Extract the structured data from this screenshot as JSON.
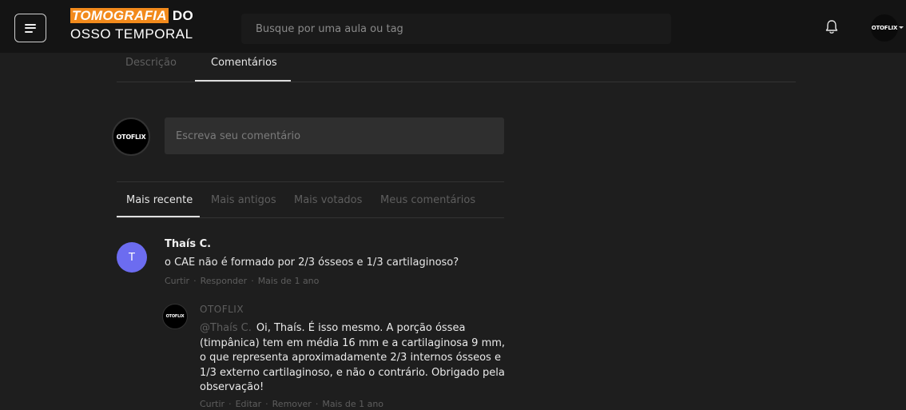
{
  "header": {
    "logo_line1_highlight": "TOMOGRAFIA",
    "logo_line1_rest": " DO",
    "logo_line2": "OSSO TEMPORAL",
    "search_placeholder": "Busque por uma aula ou tag",
    "user_avatar_text": "OTOFLIX"
  },
  "tabs": [
    {
      "label": "Descrição",
      "active": false
    },
    {
      "label": "Comentários",
      "active": true
    }
  ],
  "composer": {
    "avatar_text": "OTOFLIX",
    "placeholder": "Escreva seu comentário"
  },
  "sort_tabs": [
    {
      "label": "Mais recente",
      "active": true
    },
    {
      "label": "Mais antigos",
      "active": false
    },
    {
      "label": "Mais votados",
      "active": false
    },
    {
      "label": "Meus comentários",
      "active": false
    }
  ],
  "comment": {
    "avatar_initial": "T",
    "avatar_color": "#6c6cf0",
    "author": "Thaís C.",
    "text": "o CAE não é formado por 2/3 ósseos e 1/3 cartilaginoso?",
    "actions": [
      "Curtir",
      "Responder"
    ],
    "time": "Mais de 1 ano"
  },
  "reply": {
    "avatar_text": "OTOFLIX",
    "author": "OTOFLIX",
    "mention": "@Thaís C.",
    "text": "Oi, Thaís. É isso mesmo. A porção óssea (timpânica) tem em média 16 mm e a cartilaginosa 9 mm, o que representa aproximadamente 2/3 internos ósseos e 1/3 externo cartilaginoso, e não o contrário. Obrigado pela observação!",
    "actions": [
      "Curtir",
      "Editar",
      "Remover"
    ],
    "time": "Mais de 1 ano"
  },
  "colors": {
    "background": "#1e1e1e",
    "topbar": "#141414",
    "logo_highlight": "#f28a1c"
  }
}
